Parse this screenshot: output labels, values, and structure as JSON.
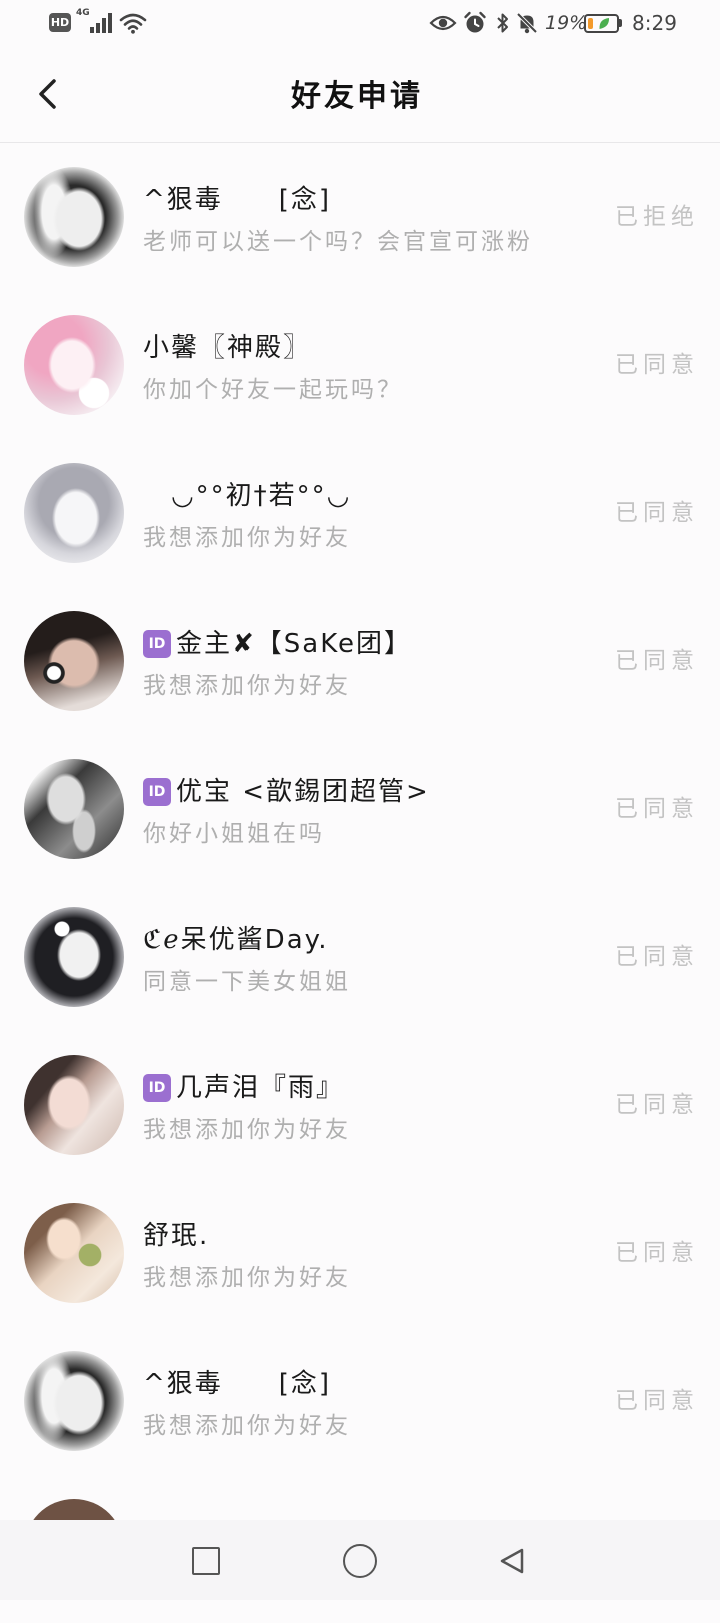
{
  "status_bar": {
    "hd_label": "HD",
    "network_label": "4G",
    "battery_percent": "19%",
    "battery_level": 0.19,
    "time": "8:29",
    "icons": [
      "signal-icon",
      "wifi-icon",
      "eye-icon",
      "alarm-icon",
      "bluetooth-icon",
      "bell-off-icon",
      "battery-saver-icon"
    ]
  },
  "header": {
    "title": "好友申请",
    "back_icon": "chevron-left-icon"
  },
  "id_badge": "ID",
  "requests": [
    {
      "name": "^狠毒　　[念]",
      "message": "老师可以送一个吗？会官宣可涨粉",
      "status": "已拒绝",
      "has_id_badge": false
    },
    {
      "name": "小馨〖神殿〗",
      "message": "你加个好友一起玩吗？",
      "status": "已同意",
      "has_id_badge": false
    },
    {
      "name": "◡°°初†若°°◡",
      "message": "我想添加你为好友",
      "status": "已同意",
      "has_id_badge": false
    },
    {
      "name": "金主✘【SaKe团】",
      "message": "我想添加你为好友",
      "status": "已同意",
      "has_id_badge": true
    },
    {
      "name": "优宝 <歆錫团超管>",
      "message": "你好小姐姐在吗",
      "status": "已同意",
      "has_id_badge": true
    },
    {
      "name": "ℭℯ呆优酱Day.",
      "message": "同意一下美女姐姐",
      "status": "已同意",
      "has_id_badge": false
    },
    {
      "name": "几声泪『雨』",
      "message": "我想添加你为好友",
      "status": "已同意",
      "has_id_badge": true
    },
    {
      "name": "舒珉.",
      "message": "我想添加你为好友",
      "status": "已同意",
      "has_id_badge": false
    },
    {
      "name": "^狠毒　　[念]",
      "message": "我想添加你为好友",
      "status": "已同意",
      "has_id_badge": false
    }
  ],
  "nav_bar": {
    "icons": [
      "recent-apps-icon",
      "home-icon",
      "back-icon"
    ]
  },
  "colors": {
    "name_text": "#1a1a1a",
    "message_text": "#afafaf",
    "status_text": "#c3c3c3",
    "id_badge": "#9b6fd0",
    "battery_fill": "#f39a2b",
    "battery_leaf": "#4caf50",
    "nav_bar_bg": "#f6f5f7"
  }
}
